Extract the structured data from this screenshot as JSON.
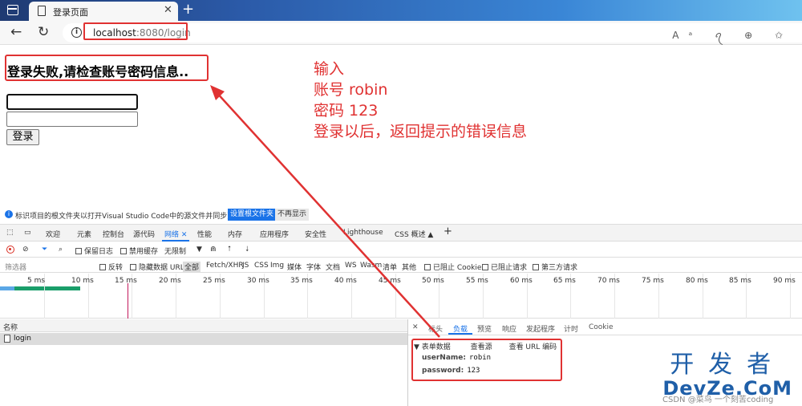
{
  "browser": {
    "tab_title": "登录页面",
    "tab_close": "✕",
    "new_tab": "+",
    "url_host": "localhost",
    "url_rest": ":8080/login",
    "info_glyph": "i",
    "omni_icons": "Aᵃ ꪖ ⊕ ✩"
  },
  "page": {
    "error_message": "登录失败,请检查账号密码信息..",
    "username_value": "",
    "password_value": "",
    "login_button": "登录"
  },
  "annotation": {
    "line1": "输入",
    "line2": "账号 robin",
    "line3": "密码 123",
    "line4": "登录以后，返回提示的错误信息",
    "color": "#e03232"
  },
  "devtools": {
    "info_message": "标识项目的根文件夹以打开Visual Studio Code中的源文件并同步更改。",
    "info_btn_primary": "设置根文件夹",
    "info_btn_secondary": "不再显示",
    "tabs": [
      "欢迎",
      "元素",
      "控制台",
      "源代码",
      "网络 ✕",
      "性能",
      "内存",
      "应用程序",
      "安全性",
      "Lighthouse",
      "CSS 概述 ▲",
      "+"
    ],
    "active_tab": "网络",
    "toolbar": {
      "preserve_log": "保留日志",
      "disable_cache": "禁用缓存",
      "throttle": "无限制"
    },
    "filter": {
      "placeholder": "筛选器",
      "invert": "反转",
      "hide_data_url": "隐藏数据 URL",
      "all": "全部",
      "types": [
        "Fetch/XHR",
        "JS",
        "CSS",
        "Img",
        "媒体",
        "字体",
        "文档",
        "WS",
        "Wasm",
        "清单",
        "其他"
      ],
      "blocked_cookie": "已阻止 Cookie",
      "blocked_requests": "已阻止请求",
      "third_party": "第三方请求"
    },
    "timeline_ticks": [
      "5 ms",
      "10 ms",
      "15 ms",
      "20 ms",
      "25 ms",
      "30 ms",
      "35 ms",
      "40 ms",
      "45 ms",
      "50 ms",
      "55 ms",
      "60 ms",
      "65 ms",
      "70 ms",
      "75 ms",
      "80 ms",
      "85 ms",
      "90 ms"
    ],
    "request_list": {
      "header": "名称",
      "rows": [
        "login"
      ]
    },
    "detail_tabs": [
      "✕",
      "标头",
      "负载",
      "预览",
      "响应",
      "发起程序",
      "计时",
      "Cookie"
    ],
    "payload": {
      "section": "▼ 表单数据",
      "view_source": "查看源",
      "view_url_encoded": "查看 URL 编码",
      "fields": [
        {
          "key": "userName:",
          "value": "robin"
        },
        {
          "key": "password:",
          "value": "123"
        }
      ]
    }
  },
  "watermark": {
    "cn": "开发者",
    "en": "DevZe.CoM",
    "credit": "CSDN @菜鸟 一个刻苦coding"
  }
}
